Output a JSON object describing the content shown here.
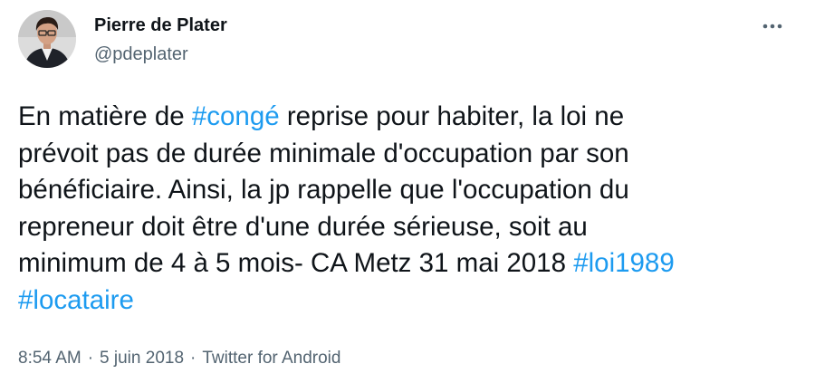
{
  "author": {
    "name": "Pierre de Plater",
    "handle": "@pdeplater"
  },
  "icons": {
    "more": "more-horizontal-icon",
    "avatar": "profile-photo"
  },
  "tweet": {
    "lines": [
      [
        {
          "text": "En matière de ",
          "type": "text"
        },
        {
          "text": "#congé",
          "type": "hashtag"
        },
        {
          "text": " reprise pour habiter, la loi ne",
          "type": "text"
        }
      ],
      [
        {
          "text": "prévoit pas de durée minimale d'occupation par son",
          "type": "text"
        }
      ],
      [
        {
          "text": "bénéficiaire. Ainsi, la jp rappelle que l'occupation du",
          "type": "text"
        }
      ],
      [
        {
          "text": "repreneur doit être d'une durée sérieuse, soit au",
          "type": "text"
        }
      ],
      [
        {
          "text": "minimum de 4 à 5 mois- CA Metz 31 mai 2018 ",
          "type": "text"
        },
        {
          "text": "#loi1989",
          "type": "hashtag"
        }
      ],
      [
        {
          "text": "#locataire",
          "type": "hashtag"
        }
      ]
    ]
  },
  "meta": {
    "time": "8:54 AM",
    "separator": "·",
    "date": "5 juin 2018",
    "source": "Twitter for Android"
  },
  "colors": {
    "hashtag": "#1d9bf0",
    "text": "#0f1419",
    "secondary": "#536471"
  }
}
